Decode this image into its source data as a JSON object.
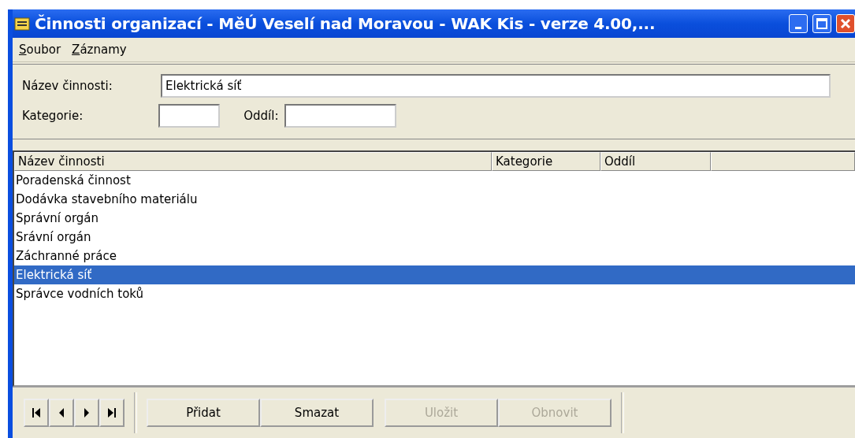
{
  "window": {
    "title": "Činnosti organizací - MěÚ Veselí nad Moravou - WAK Kis - verze 4.00,..."
  },
  "menu": [
    "Soubor",
    "Záznamy"
  ],
  "form": {
    "name_label": "Název činnosti:",
    "name_value": "Elektrická síť",
    "category_label": "Kategorie:",
    "section_label": "Oddíl:"
  },
  "table": {
    "columns": [
      "Název činnosti",
      "Kategorie",
      "Oddíl"
    ],
    "rows": [
      {
        "name": "Poradenská činnost",
        "selected": false
      },
      {
        "name": "Dodávka stavebního materiálu",
        "selected": false
      },
      {
        "name": "Správní orgán",
        "selected": false
      },
      {
        "name": "Srávní orgán",
        "selected": false
      },
      {
        "name": "Záchranné práce",
        "selected": false
      },
      {
        "name": "Elektrická síť",
        "selected": true
      },
      {
        "name": "Správce vodních toků",
        "selected": false
      }
    ]
  },
  "navigation": [
    {
      "kind": "first"
    },
    {
      "kind": "prev"
    },
    {
      "kind": "next"
    },
    {
      "kind": "last"
    }
  ],
  "buttons": [
    {
      "label": "Přidat",
      "disabled": false
    },
    {
      "label": "Smazat",
      "disabled": false
    },
    {
      "label": "Uložit",
      "disabled": true
    },
    {
      "label": "Obnovit",
      "disabled": true
    }
  ]
}
